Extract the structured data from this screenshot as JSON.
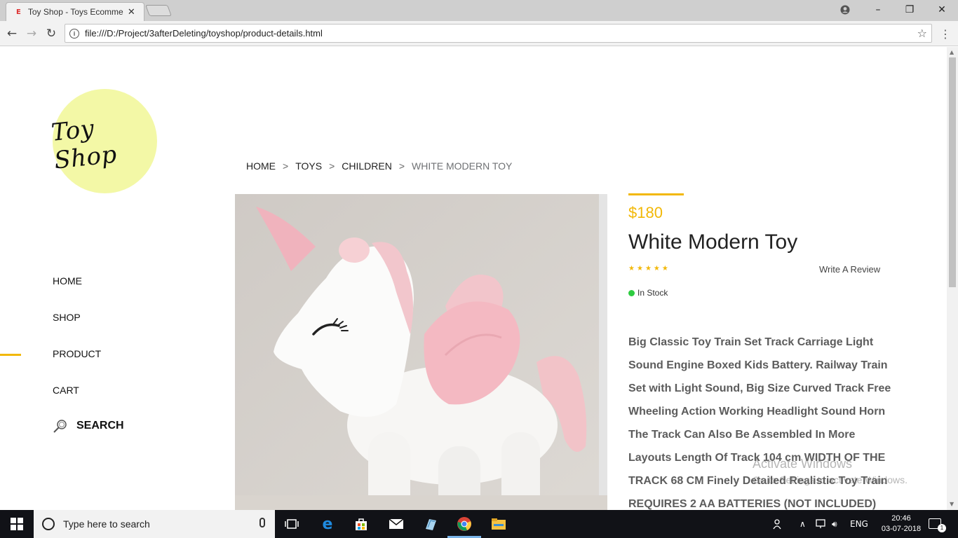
{
  "browser": {
    "tab_title": "Toy Shop - Toys Ecommerce",
    "tab_favicon": "E",
    "url": "file:///D:/Project/3afterDeleting/toyshop/product-details.html"
  },
  "site": {
    "logo_text": "Toy Shop",
    "logo_color": "#f3f8a6",
    "accent_color": "#f2b807",
    "nav": [
      {
        "label": "HOME",
        "active": false
      },
      {
        "label": "SHOP",
        "active": false
      },
      {
        "label": "PRODUCT",
        "active": true
      },
      {
        "label": "CART",
        "active": false
      }
    ],
    "search_label": "SEARCH"
  },
  "breadcrumb": {
    "items": [
      "HOME",
      "TOYS",
      "CHILDREN"
    ],
    "current": "WHITE MODERN TOY",
    "separator": ">"
  },
  "product": {
    "image_subject": "white unicorn plush toy with pink horn and wings",
    "price": "$180",
    "title": "White Modern Toy",
    "rating": 5,
    "review_link": "Write A Review",
    "stock": "In Stock",
    "stock_color": "#2ecc40",
    "description_lines": [
      "Big Classic Toy Train Set Track Carriage Light",
      "Sound Engine Boxed Kids Battery. Railway Train",
      "Set with Light Sound, Big Size Curved Track Free",
      "Wheeling Action Working Headlight Sound Horn",
      "The Track Can Also Be Assembled In More",
      "Layouts Length Of Track 104 cm WIDTH OF THE",
      "TRACK 68 CM Finely Detailed Realistic Toy Train",
      "REQUIRES 2 AA BATTERIES (NOT INCLUDED)"
    ]
  },
  "watermark": {
    "line1": "Activate Windows",
    "line2": "Go to Settings to activate Windows."
  },
  "taskbar": {
    "search_placeholder": "Type here to search",
    "language": "ENG",
    "time": "20:46",
    "date": "03-07-2018"
  }
}
